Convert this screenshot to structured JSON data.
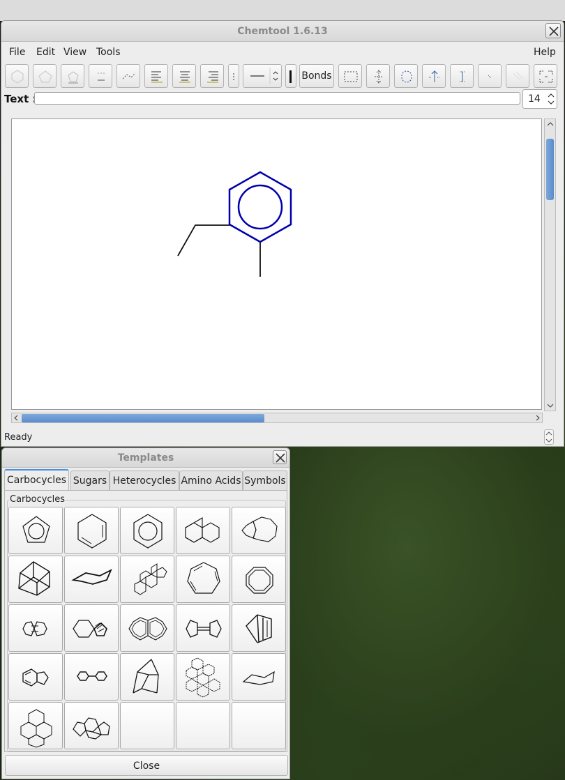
{
  "main_window": {
    "title": "Chemtool 1.6.13",
    "menu": [
      "File",
      "Edit",
      "View",
      "Tools",
      "Help"
    ],
    "toolbar": {
      "bonds_label": "Bonds"
    },
    "text_label": "Text :",
    "text_value": "",
    "font_size": "14",
    "status": "Ready"
  },
  "templates_window": {
    "title": "Templates",
    "tabs": [
      "Carbocycles",
      "Sugars",
      "Heterocycles",
      "Amino Acids",
      "Symbols"
    ],
    "active_tab": "Carbocycles",
    "group_label": "Carbocycles",
    "close_label": "Close",
    "templates": [
      "cyclopentadienyl",
      "cyclohexane",
      "benzene",
      "naphthalene",
      "azulene",
      "adamantane",
      "chair-cyclohexane",
      "steroid",
      "cycloheptatriene",
      "cyclooctatetraene",
      "pentalene",
      "spiro-compound",
      "heptalene",
      "fulvalene",
      "barrelene",
      "indane",
      "biphenyl",
      "norbornane",
      "polycyclic-aromatic",
      "cyclohexane-chair-2",
      "dodecahedrane-like",
      "tetracyclic",
      "",
      "",
      ""
    ]
  },
  "colors": {
    "molecule_selected": "#0000aa",
    "scroll_accent": "#5a8ccc"
  }
}
